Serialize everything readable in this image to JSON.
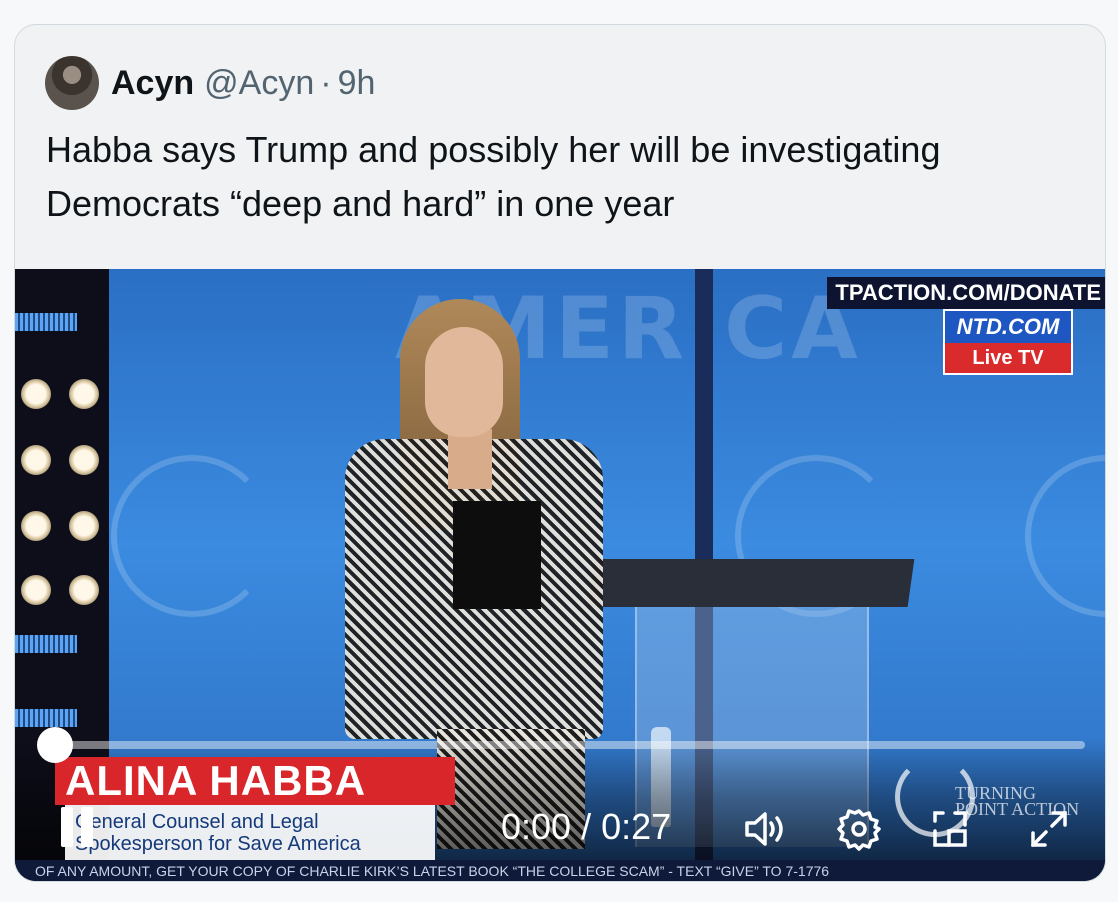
{
  "tweet": {
    "author_name": "Acyn",
    "author_handle": "@Acyn",
    "separator": "·",
    "time": "9h",
    "text": "Habba says Trump and possibly her will be investigating Democrats “deep and hard” in one year"
  },
  "video": {
    "overlay_url": "TPACTION.COM/DONATE",
    "ntd_brand": "NTD.COM",
    "ntd_live": "Live TV",
    "lower_third_name": "ALINA HABBA",
    "lower_third_role_line1": "General Counsel and Legal",
    "lower_third_role_line2": "Spokesperson for Save America",
    "ticker": "OF ANY AMOUNT, GET YOUR COPY OF CHARLIE KIRK’S LATEST BOOK “THE COLLEGE SCAM” - TEXT “GIVE” TO 7-1776",
    "tp_mark_line1": "TURNING",
    "tp_mark_line2": "POINT ACTION",
    "background_word": "AMERICA"
  },
  "player": {
    "current_time": "0:00",
    "duration": "0:27",
    "time_separator": " / ",
    "progress_fraction": 0.0,
    "icons": {
      "play_state": "pause-icon",
      "volume": "volume-icon",
      "settings": "gear-icon",
      "pip": "picture-in-picture-icon",
      "fullscreen": "fullscreen-icon"
    }
  },
  "colors": {
    "lower_third_red": "#d9262b",
    "ntd_blue": "#1f57c2",
    "ntd_red": "#d92b2b",
    "text_primary": "#0f1419",
    "text_secondary": "#536471"
  }
}
